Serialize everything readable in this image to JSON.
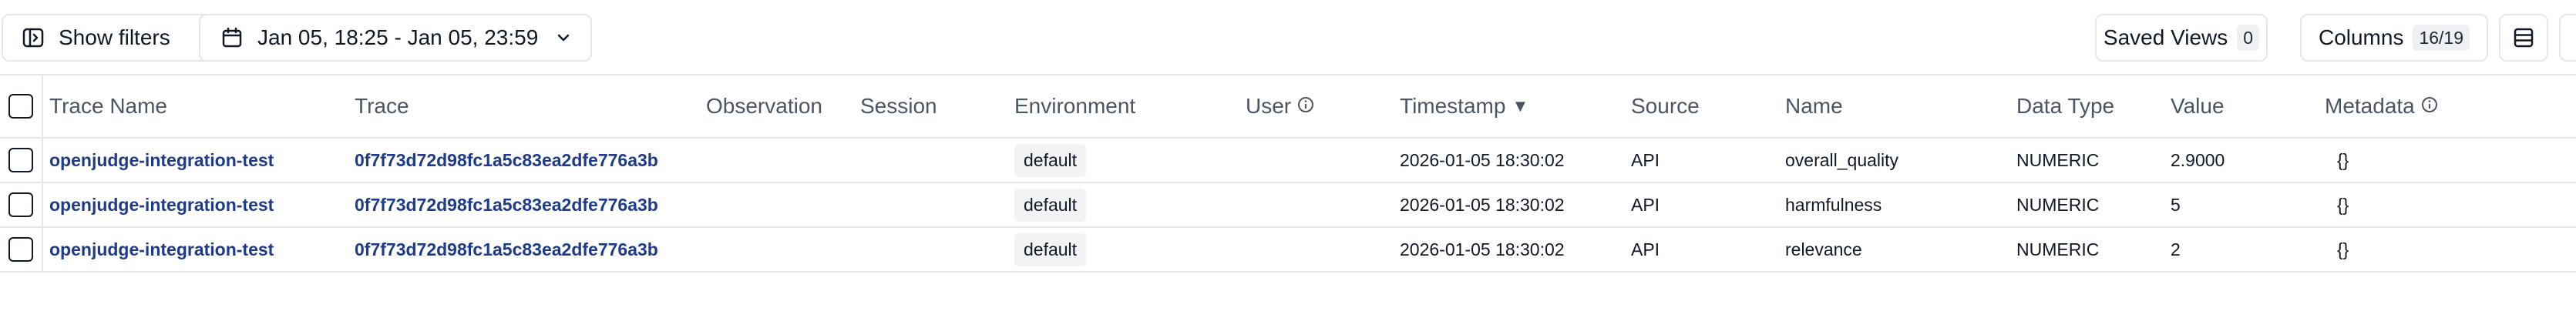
{
  "toolbar": {
    "show_filters": "Show filters",
    "date_range": "Jan 05, 18:25 - Jan 05, 23:59",
    "saved_views_label": "Saved Views",
    "saved_views_count": "0",
    "columns_label": "Columns",
    "columns_count": "16/19"
  },
  "columns": [
    {
      "label": "Trace Name"
    },
    {
      "label": "Trace"
    },
    {
      "label": "Observation"
    },
    {
      "label": "Session"
    },
    {
      "label": "Environment"
    },
    {
      "label": "User"
    },
    {
      "label": "Timestamp"
    },
    {
      "label": "Source"
    },
    {
      "label": "Name"
    },
    {
      "label": "Data Type"
    },
    {
      "label": "Value"
    },
    {
      "label": "Metadata"
    }
  ],
  "sort": {
    "column": "Timestamp",
    "direction": "desc",
    "indicator": "▼"
  },
  "rows": [
    {
      "trace_name": "openjudge-integration-test",
      "trace": "0f7f73d72d98fc1a5c83ea2dfe776a3b",
      "environment": "default",
      "timestamp": "2026-01-05 18:30:02",
      "source": "API",
      "name": "overall_quality",
      "data_type": "NUMERIC",
      "value": "2.9000",
      "metadata": "{}"
    },
    {
      "trace_name": "openjudge-integration-test",
      "trace": "0f7f73d72d98fc1a5c83ea2dfe776a3b",
      "environment": "default",
      "timestamp": "2026-01-05 18:30:02",
      "source": "API",
      "name": "harmfulness",
      "data_type": "NUMERIC",
      "value": "5",
      "metadata": "{}"
    },
    {
      "trace_name": "openjudge-integration-test",
      "trace": "0f7f73d72d98fc1a5c83ea2dfe776a3b",
      "environment": "default",
      "timestamp": "2026-01-05 18:30:02",
      "source": "API",
      "name": "relevance",
      "data_type": "NUMERIC",
      "value": "2",
      "metadata": "{}"
    }
  ]
}
